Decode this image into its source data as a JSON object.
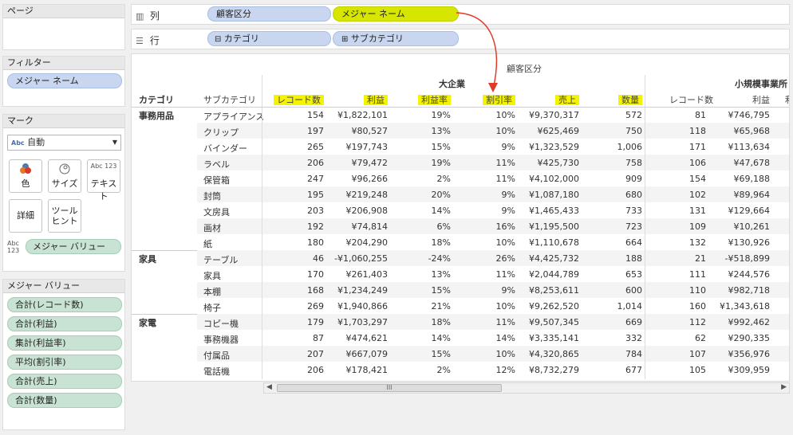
{
  "pages": {
    "title": "ページ"
  },
  "filters": {
    "title": "フィルター",
    "pill": "メジャー ネーム"
  },
  "marks": {
    "title": "マーク",
    "dropdown": {
      "abc_badge": "Abc",
      "selected": "自動"
    },
    "buttons": {
      "color": "色",
      "size": "サイズ",
      "text": "テキスト",
      "text_icon": "Abc 123",
      "detail": "詳細",
      "tooltip": "ツール ヒント"
    },
    "measure_pill": {
      "badge": "Abc 123",
      "label": "メジャー バリュー"
    }
  },
  "measure_values": {
    "title": "メジャー バリュー",
    "items": [
      "合計(レコード数)",
      "合計(利益)",
      "集計(利益率)",
      "平均(割引率)",
      "合計(売上)",
      "合計(数量)"
    ]
  },
  "columns_shelf": {
    "label": "列",
    "pills": [
      "顧客区分",
      "メジャー ネーム"
    ]
  },
  "rows_shelf": {
    "label": "行",
    "pills": [
      "カテゴリ",
      "サブカテゴリ"
    ]
  },
  "table": {
    "title": "顧客区分",
    "segments": [
      "大企業",
      "小規模事業所"
    ],
    "row_headers": [
      "カテゴリ",
      "サブカテゴリ"
    ],
    "measures": [
      "レコード数",
      "利益",
      "利益率",
      "割引率",
      "売上",
      "数量"
    ],
    "measures2": [
      "レコード数",
      "利益",
      "利"
    ],
    "groups": [
      {
        "category": "事務用品",
        "rows": [
          {
            "sub": "アプライアンス",
            "v": [
              "154",
              "¥1,822,101",
              "19%",
              "10%",
              "¥9,370,317",
              "572"
            ],
            "w": [
              "81",
              "¥746,795"
            ]
          },
          {
            "sub": "クリップ",
            "v": [
              "197",
              "¥80,527",
              "13%",
              "10%",
              "¥625,469",
              "750"
            ],
            "w": [
              "118",
              "¥65,968"
            ]
          },
          {
            "sub": "バインダー",
            "v": [
              "265",
              "¥197,743",
              "15%",
              "9%",
              "¥1,323,529",
              "1,006"
            ],
            "w": [
              "171",
              "¥113,634"
            ]
          },
          {
            "sub": "ラベル",
            "v": [
              "206",
              "¥79,472",
              "19%",
              "11%",
              "¥425,730",
              "758"
            ],
            "w": [
              "106",
              "¥47,678"
            ]
          },
          {
            "sub": "保管箱",
            "v": [
              "247",
              "¥96,266",
              "2%",
              "11%",
              "¥4,102,000",
              "909"
            ],
            "w": [
              "154",
              "¥69,188"
            ]
          },
          {
            "sub": "封筒",
            "v": [
              "195",
              "¥219,248",
              "20%",
              "9%",
              "¥1,087,180",
              "680"
            ],
            "w": [
              "102",
              "¥89,964"
            ]
          },
          {
            "sub": "文房具",
            "v": [
              "203",
              "¥206,908",
              "14%",
              "9%",
              "¥1,465,433",
              "733"
            ],
            "w": [
              "131",
              "¥129,664"
            ]
          },
          {
            "sub": "画材",
            "v": [
              "192",
              "¥74,814",
              "6%",
              "16%",
              "¥1,195,500",
              "723"
            ],
            "w": [
              "109",
              "¥10,261"
            ]
          },
          {
            "sub": "紙",
            "v": [
              "180",
              "¥204,290",
              "18%",
              "10%",
              "¥1,110,678",
              "664"
            ],
            "w": [
              "132",
              "¥130,926"
            ]
          }
        ]
      },
      {
        "category": "家具",
        "rows": [
          {
            "sub": "テーブル",
            "v": [
              "46",
              "-¥1,060,255",
              "-24%",
              "26%",
              "¥4,425,732",
              "188"
            ],
            "w": [
              "21",
              "-¥518,899"
            ]
          },
          {
            "sub": "家具",
            "v": [
              "170",
              "¥261,403",
              "13%",
              "11%",
              "¥2,044,789",
              "653"
            ],
            "w": [
              "111",
              "¥244,576"
            ]
          },
          {
            "sub": "本棚",
            "v": [
              "168",
              "¥1,234,249",
              "15%",
              "9%",
              "¥8,253,611",
              "600"
            ],
            "w": [
              "110",
              "¥982,718"
            ]
          },
          {
            "sub": "椅子",
            "v": [
              "269",
              "¥1,940,866",
              "21%",
              "10%",
              "¥9,262,520",
              "1,014"
            ],
            "w": [
              "160",
              "¥1,343,618"
            ]
          }
        ]
      },
      {
        "category": "家電",
        "rows": [
          {
            "sub": "コピー機",
            "v": [
              "179",
              "¥1,703,297",
              "18%",
              "11%",
              "¥9,507,345",
              "669"
            ],
            "w": [
              "112",
              "¥992,462"
            ]
          },
          {
            "sub": "事務機器",
            "v": [
              "87",
              "¥474,621",
              "14%",
              "14%",
              "¥3,335,141",
              "332"
            ],
            "w": [
              "62",
              "¥290,335"
            ]
          },
          {
            "sub": "付属品",
            "v": [
              "207",
              "¥667,079",
              "15%",
              "10%",
              "¥4,320,865",
              "784"
            ],
            "w": [
              "107",
              "¥356,976"
            ]
          },
          {
            "sub": "電話機",
            "v": [
              "206",
              "¥178,421",
              "2%",
              "12%",
              "¥8,732,279",
              "677"
            ],
            "w": [
              "105",
              "¥309,959"
            ]
          }
        ]
      }
    ]
  },
  "scrollbar": {
    "thumb_grip": "III",
    "left_arrow": "◀",
    "right_arrow": "▶"
  },
  "colors": {
    "highlight": "#d7e600",
    "pill_blue": "#c8d7ef",
    "pill_green": "#c8e3d3",
    "arrow": "#e03a2a"
  }
}
